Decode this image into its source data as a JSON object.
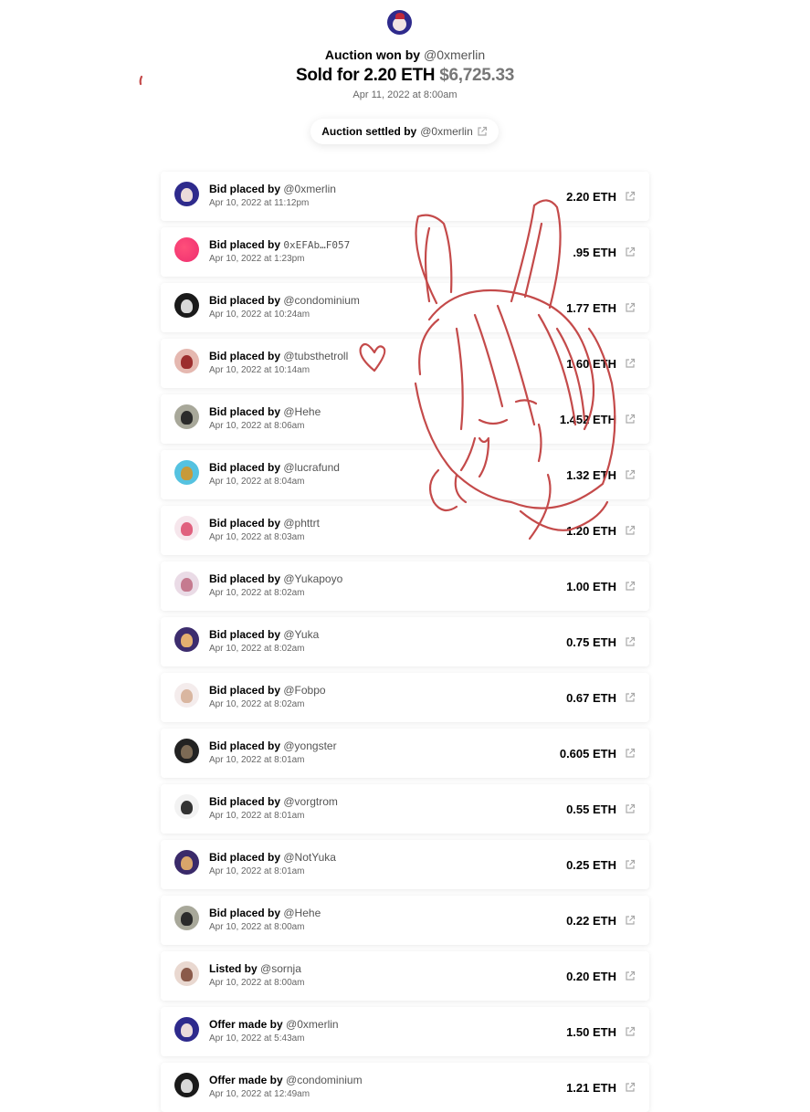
{
  "header": {
    "won_prefix": "Auction won by",
    "won_user": "@0xmerlin",
    "sold_prefix": "Sold for 2.20 ETH",
    "sold_usd": "$6,725.33",
    "sold_date": "Apr 11, 2022 at 8:00am",
    "settled_prefix": "Auction settled by",
    "settled_user": "@0xmerlin"
  },
  "colors": {
    "accent_sketch": "#c44a4a",
    "muted_text": "#555555"
  },
  "rows": [
    {
      "action": "Bid placed by",
      "user": "@0xmerlin",
      "date": "Apr 10, 2022 at 11:12pm",
      "amount": "2.20 ETH",
      "avatar": "merlin"
    },
    {
      "action": "Bid placed by",
      "user": "0xEFAb…F057",
      "date": "Apr 10, 2022 at 1:23pm",
      "amount": ".95 ETH",
      "avatar": "pink"
    },
    {
      "action": "Bid placed by",
      "user": "@condominium",
      "date": "Apr 10, 2022 at 10:24am",
      "amount": "1.77 ETH",
      "avatar": "dark"
    },
    {
      "action": "Bid placed by",
      "user": "@tubsthetroll",
      "date": "Apr 10, 2022 at 10:14am",
      "amount": "1.60 ETH",
      "avatar": "troll"
    },
    {
      "action": "Bid placed by",
      "user": "@Hehe",
      "date": "Apr 10, 2022 at 8:06am",
      "amount": "1.452 ETH",
      "avatar": "hehe"
    },
    {
      "action": "Bid placed by",
      "user": "@lucrafund",
      "date": "Apr 10, 2022 at 8:04am",
      "amount": "1.32 ETH",
      "avatar": "lucra"
    },
    {
      "action": "Bid placed by",
      "user": "@phttrt",
      "date": "Apr 10, 2022 at 8:03am",
      "amount": "1.20 ETH",
      "avatar": "phttrt"
    },
    {
      "action": "Bid placed by",
      "user": "@Yukapoyo",
      "date": "Apr 10, 2022 at 8:02am",
      "amount": "1.00 ETH",
      "avatar": "yukapoyo"
    },
    {
      "action": "Bid placed by",
      "user": "@Yuka",
      "date": "Apr 10, 2022 at 8:02am",
      "amount": "0.75 ETH",
      "avatar": "yuka"
    },
    {
      "action": "Bid placed by",
      "user": "@Fobpo",
      "date": "Apr 10, 2022 at 8:02am",
      "amount": "0.67 ETH",
      "avatar": "fobpo"
    },
    {
      "action": "Bid placed by",
      "user": "@yongster",
      "date": "Apr 10, 2022 at 8:01am",
      "amount": "0.605 ETH",
      "avatar": "yongster"
    },
    {
      "action": "Bid placed by",
      "user": "@vorgtrom",
      "date": "Apr 10, 2022 at 8:01am",
      "amount": "0.55 ETH",
      "avatar": "vorgtrom"
    },
    {
      "action": "Bid placed by",
      "user": "@NotYuka",
      "date": "Apr 10, 2022 at 8:01am",
      "amount": "0.25 ETH",
      "avatar": "notyuka"
    },
    {
      "action": "Bid placed by",
      "user": "@Hehe",
      "date": "Apr 10, 2022 at 8:00am",
      "amount": "0.22 ETH",
      "avatar": "hehe"
    },
    {
      "action": "Listed by",
      "user": "@sornja",
      "date": "Apr 10, 2022 at 8:00am",
      "amount": "0.20 ETH",
      "avatar": "sornja"
    },
    {
      "action": "Offer made by",
      "user": "@0xmerlin",
      "date": "Apr 10, 2022 at 5:43am",
      "amount": "1.50 ETH",
      "avatar": "merlin"
    },
    {
      "action": "Offer made by",
      "user": "@condominium",
      "date": "Apr 10, 2022 at 12:49am",
      "amount": "1.21 ETH",
      "avatar": "dark"
    }
  ]
}
